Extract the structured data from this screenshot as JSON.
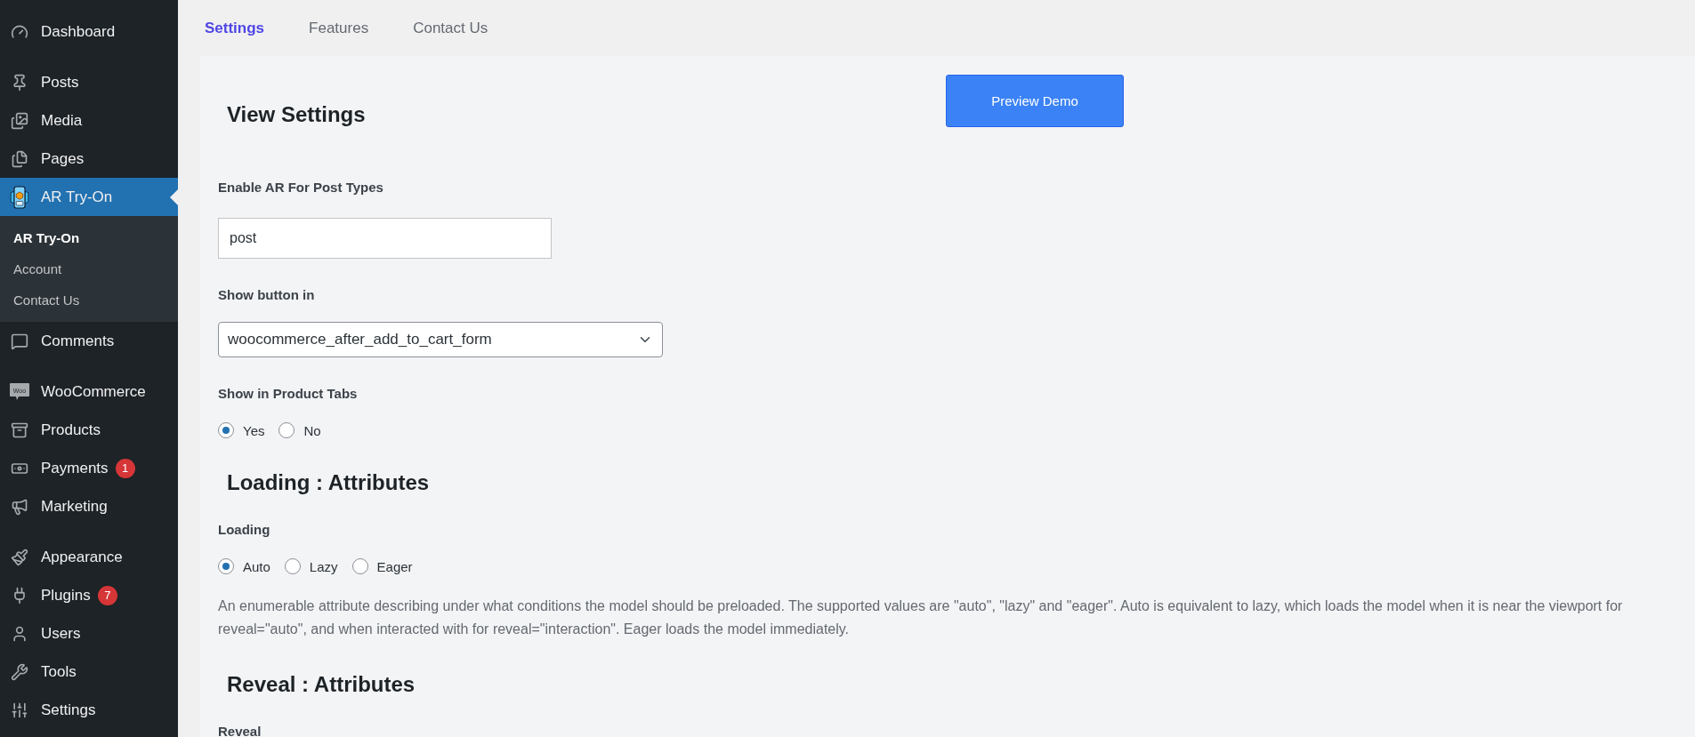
{
  "sidebar": {
    "groups": [
      [
        {
          "label": "Dashboard",
          "selected": false
        }
      ],
      [
        {
          "label": "Posts",
          "selected": false
        },
        {
          "label": "Media",
          "selected": false
        },
        {
          "label": "Pages",
          "selected": false
        },
        {
          "label": "AR Try-On",
          "selected": true,
          "children": [
            {
              "label": "AR Try-On",
              "selected": true
            },
            {
              "label": "Account",
              "selected": false
            },
            {
              "label": "Contact Us",
              "selected": false
            }
          ]
        },
        {
          "label": "Comments",
          "selected": false
        }
      ],
      [
        {
          "label": "WooCommerce",
          "selected": false,
          "icon_text": "Woo"
        },
        {
          "label": "Products",
          "selected": false
        },
        {
          "label": "Payments",
          "selected": false,
          "badge": "1"
        },
        {
          "label": "Marketing",
          "selected": false
        }
      ],
      [
        {
          "label": "Appearance",
          "selected": false
        },
        {
          "label": "Plugins",
          "selected": false,
          "badge": "7"
        },
        {
          "label": "Users",
          "selected": false
        },
        {
          "label": "Tools",
          "selected": false
        },
        {
          "label": "Settings",
          "selected": false
        }
      ]
    ]
  },
  "tabs": [
    {
      "label": "Settings",
      "selected": true
    },
    {
      "label": "Features",
      "selected": false
    },
    {
      "label": "Contact Us",
      "selected": false
    }
  ],
  "preview_button": "Preview Demo",
  "sections": [
    {
      "title": "View Settings",
      "fields": [
        {
          "kind": "text",
          "label": "Enable AR For Post Types",
          "value": "post"
        },
        {
          "kind": "select",
          "label": "Show button in",
          "value": "woocommerce_after_add_to_cart_form"
        },
        {
          "kind": "radio",
          "label": "Show in Product Tabs",
          "options": [
            {
              "label": "Yes",
              "selected": true
            },
            {
              "label": "No",
              "selected": false
            }
          ]
        }
      ]
    },
    {
      "title": "Loading : Attributes",
      "fields": [
        {
          "kind": "radio",
          "label": "Loading",
          "options": [
            {
              "label": "Auto",
              "selected": true
            },
            {
              "label": "Lazy",
              "selected": false
            },
            {
              "label": "Eager",
              "selected": false
            }
          ],
          "description": "An enumerable attribute describing under what conditions the model should be preloaded. The supported values are \"auto\", \"lazy\" and \"eager\". Auto is equivalent to lazy, which loads the model when it is near the viewport for reveal=\"auto\", and when interacted with for reveal=\"interaction\". Eager loads the model immediately."
        }
      ]
    },
    {
      "title": "Reveal : Attributes",
      "fields": [
        {
          "kind": "label",
          "label": "Reveal"
        }
      ]
    }
  ]
}
